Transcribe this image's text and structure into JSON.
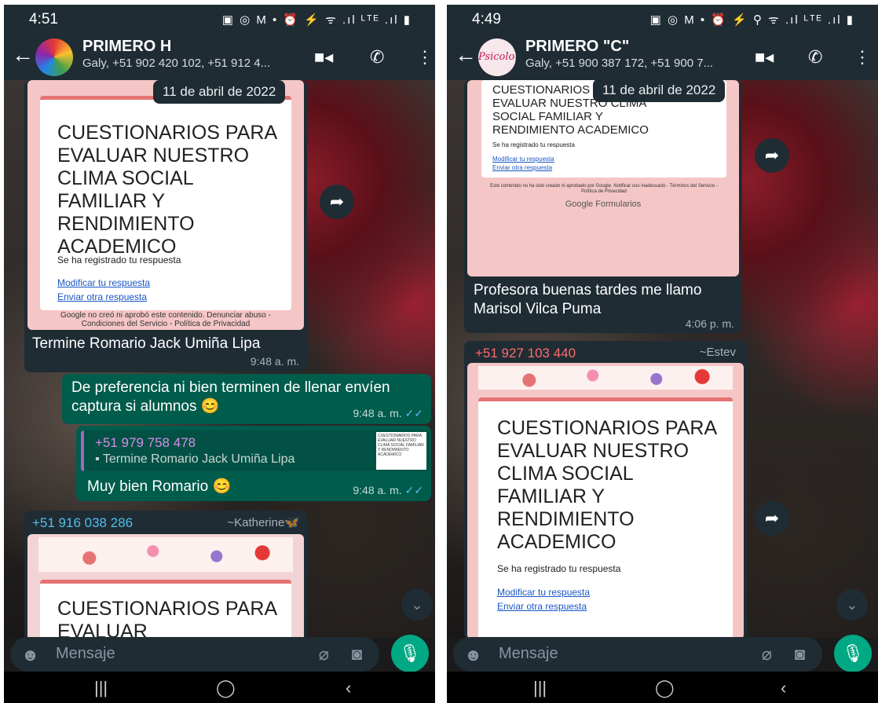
{
  "left": {
    "status": {
      "time": "4:51",
      "icons": "▣ ◎ M •      ⏰ ⚡ ᯤ .ıl ᴸᵀᴱ .ıl ▮"
    },
    "header": {
      "title": "PRIMERO  H",
      "subtitle": "Galy, +51 902 420 102, +51 912 4..."
    },
    "date_chip": "11 de abril de 2022",
    "form1": {
      "heading": "CUESTIONARIOS PARA EVALUAR NUESTRO CLIMA SOCIAL FAMILIAR Y RENDIMIENTO ACADEMICO",
      "registered": "Se ha registrado tu respuesta",
      "edit_link": "Modificar tu respuesta",
      "again_link": "Enviar otra respuesta",
      "footer": "Google no creó ni aprobó este contenido. Denunciar abuso - Condiciones del Servicio - Política de Privacidad"
    },
    "msg1": {
      "text": "Termine Romario Jack Umiña Lipa",
      "time": "9:48 a. m."
    },
    "msg2": {
      "text": "De preferencia ni bien terminen de llenar envíen captura si alumnos 😊",
      "time": "9:48 a. m."
    },
    "msg3": {
      "quote_sender": "+51 979 758 478",
      "quote_text": "Termine Romario Jack Umiña Lipa",
      "thumb_text": "CUESTIONARIOS PARA EVALUAR NUESTRO CLIMA SOCIAL FAMILIAR Y RENDIMIENTO ACADEMICO",
      "text": "Muy bien Romario 😊",
      "time": "9:48 a. m."
    },
    "msg4": {
      "sender": "+51 916 038 286",
      "alias": "~Katherine🦋",
      "heading": "CUESTIONARIOS PARA EVALUAR"
    },
    "input_placeholder": "Mensaje"
  },
  "right": {
    "status": {
      "time": "4:49",
      "icons": "▣ ◎ M •      ⏰ ⚡ ⚲ ᯤ .ıl ᴸᵀᴱ .ıl ▮"
    },
    "header": {
      "title": "PRIMERO \"C\"",
      "subtitle": "Galy, +51 900 387 172, +51 900 7...",
      "avatar_text": "Psicología"
    },
    "date_chip": "11 de abril de 2022",
    "form1": {
      "heading": "CUESTIONARIOS PARA EVALUAR NUESTRO CLIMA SOCIAL FAMILIAR Y RENDIMIENTO ACADEMICO",
      "registered": "Se ha registrado tu respuesta",
      "edit_link": "Modificar tu respuesta",
      "again_link": "Enviar otra respuesta",
      "footer": "Este contenido no ha sido creado ni aprobado por Google. Notificar uso inadecuado - Términos del Servicio - Política de Privacidad",
      "brand": "Google Formularios"
    },
    "msg1": {
      "text": "Profesora buenas tardes me llamo Marisol Vilca Puma",
      "time": "4:06 p. m."
    },
    "msg2": {
      "sender": "+51 927 103 440",
      "alias": "~Estev",
      "heading": "CUESTIONARIOS PARA EVALUAR NUESTRO CLIMA SOCIAL FAMILIAR Y RENDIMIENTO ACADEMICO",
      "registered": "Se ha registrado tu respuesta",
      "edit_link": "Modificar tu respuesta",
      "again_link": "Enviar otra respuesta"
    },
    "input_placeholder": "Mensaje"
  },
  "colors": {
    "header": "#1f2c34",
    "outgoing": "#005c4b",
    "incoming": "#1f2c34",
    "accent": "#00a884",
    "form_bg": "#f5c6c6",
    "link": "#1a56c4"
  },
  "icons": [
    "back-arrow-icon",
    "video-call-icon",
    "phone-call-icon",
    "more-menu-icon",
    "forward-icon",
    "emoji-icon",
    "attach-icon",
    "camera-icon",
    "mic-icon",
    "double-check-icon",
    "scroll-down-icon"
  ]
}
